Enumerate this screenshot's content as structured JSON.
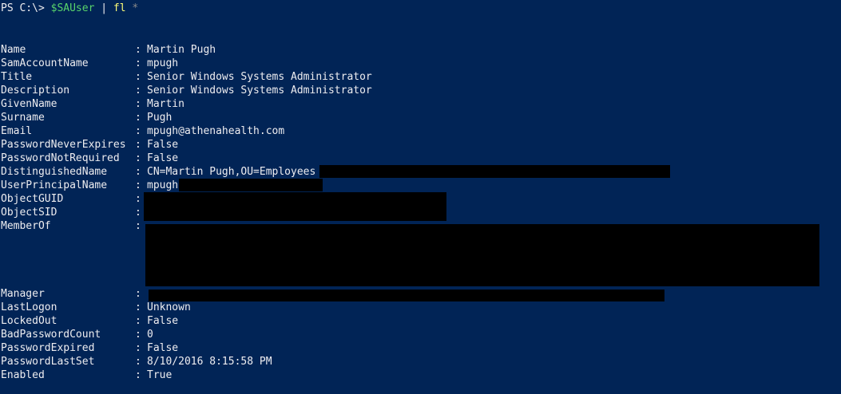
{
  "prompt": {
    "text": "PS C:\\> ",
    "variable": "$SAUser",
    "pipe": " | ",
    "command": "fl",
    "argument": " *"
  },
  "separator": ":",
  "properties": [
    {
      "name": "Name",
      "value": "Martin Pugh"
    },
    {
      "name": "SamAccountName",
      "value": "mpugh"
    },
    {
      "name": "Title",
      "value": "Senior Windows Systems Administrator"
    },
    {
      "name": "Description",
      "value": "Senior Windows Systems Administrator"
    },
    {
      "name": "GivenName",
      "value": "Martin"
    },
    {
      "name": "Surname",
      "value": "Pugh"
    },
    {
      "name": "Email",
      "value": "mpugh@athenahealth.com"
    },
    {
      "name": "PasswordNeverExpires",
      "value": "False"
    },
    {
      "name": "PasswordNotRequired",
      "value": "False"
    },
    {
      "name": "DistinguishedName",
      "value": "CN=Martin Pugh,OU=Employees"
    },
    {
      "name": "UserPrincipalName",
      "value": "mpugh"
    },
    {
      "name": "ObjectGUID",
      "value": ""
    },
    {
      "name": "ObjectSID",
      "value": ""
    },
    {
      "name": "MemberOf",
      "value": ""
    },
    {
      "name": "Manager",
      "value": ""
    },
    {
      "name": "LastLogon",
      "value": "Unknown"
    },
    {
      "name": "LockedOut",
      "value": "False"
    },
    {
      "name": "BadPasswordCount",
      "value": "0"
    },
    {
      "name": "PasswordExpired",
      "value": "False"
    },
    {
      "name": "PasswordLastSet",
      "value": "8/10/2016 8:15:58 PM"
    },
    {
      "name": "Enabled",
      "value": "True"
    }
  ],
  "colors": {
    "background": "#012456",
    "text": "#eeedf0",
    "variable": "#58d36b",
    "command": "#fdfd78",
    "argument": "#8a8a8a",
    "redaction": "#000000"
  }
}
